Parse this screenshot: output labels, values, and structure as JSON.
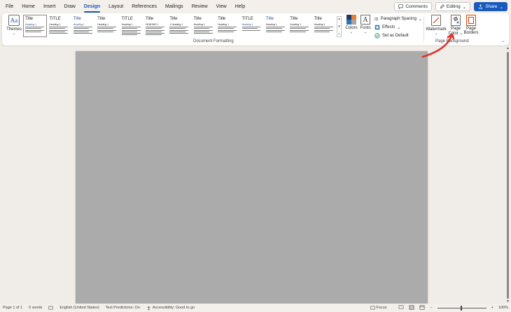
{
  "menu": {
    "items": [
      "File",
      "Home",
      "Insert",
      "Draw",
      "Design",
      "Layout",
      "References",
      "Mailings",
      "Review",
      "View",
      "Help"
    ],
    "active": "Design"
  },
  "top_right": {
    "comments_label": "Comments",
    "editing_label": "Editing",
    "share_label": "Share"
  },
  "ribbon": {
    "themes_label": "Themes",
    "document_formatting_label": "Document Formatting",
    "styles": [
      {
        "title": "Title",
        "heading": "Heading 1"
      },
      {
        "title": "TITLE",
        "heading": "Heading 1"
      },
      {
        "title": "Title",
        "heading": "Heading 1"
      },
      {
        "title": "Title",
        "heading": "Heading 1"
      },
      {
        "title": "TITLE",
        "heading": "Heading 1"
      },
      {
        "title": "Title",
        "heading": "HEADING 1"
      },
      {
        "title": "Title",
        "heading": "1 Heading 1"
      },
      {
        "title": "Title",
        "heading": "Heading 1"
      },
      {
        "title": "Title",
        "heading": "Heading 1"
      },
      {
        "title": "TITLE",
        "heading": "Heading 1"
      },
      {
        "title": "Title",
        "heading": "Heading 1"
      },
      {
        "title": "Title",
        "heading": "Heading 1"
      },
      {
        "title": "Title",
        "heading": "Heading 1"
      }
    ],
    "colors_label": "Colors",
    "fonts_label": "Fonts",
    "fonts_icon_glyph": "A",
    "paragraph_spacing_label": "Paragraph Spacing",
    "effects_label": "Effects",
    "set_default_label": "Set as Default",
    "watermark_label": "Watermark",
    "page_color_label_1": "Page",
    "page_color_label_2": "Color",
    "page_borders_label_1": "Page",
    "page_borders_label_2": "Borders",
    "page_background_label": "Page Background",
    "theme_colors": [
      "#1f3864",
      "#ed7d31",
      "#2e75b6",
      "#a5a5a5"
    ],
    "accent": "#185abd"
  },
  "document": {
    "page_color": "#ababab"
  },
  "annotation": {
    "color": "#e0312b"
  },
  "statusbar": {
    "page": "Page 1 of 1",
    "words": "0 words",
    "language": "English (United States)",
    "text_predictions": "Text Predictions: On",
    "accessibility": "Accessibility: Good to go",
    "focus": "Focus",
    "zoom": "100%"
  }
}
